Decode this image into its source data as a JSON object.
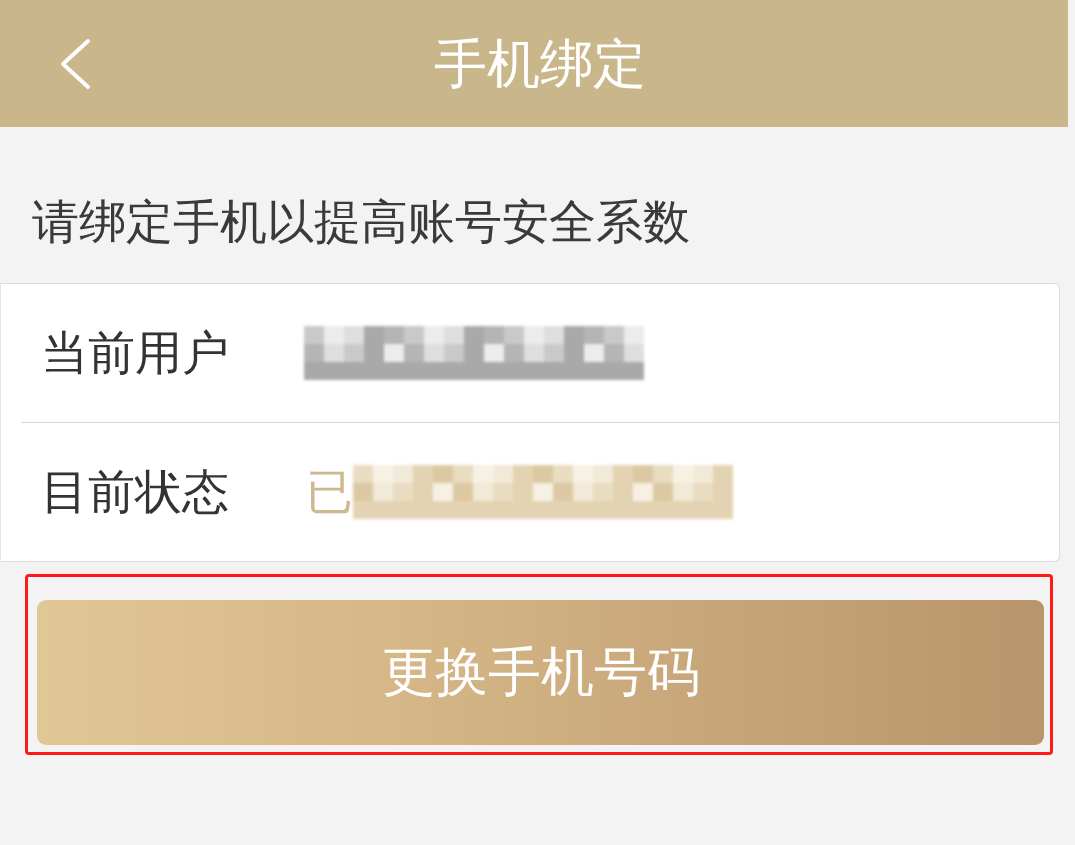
{
  "header": {
    "title": "手机绑定"
  },
  "notice": "请绑定手机以提高账号安全系数",
  "fields": [
    {
      "label": "当前用户",
      "kind": "account",
      "redacted": true
    },
    {
      "label": "目前状态",
      "kind": "status",
      "value": "已",
      "redacted": true
    }
  ],
  "action": {
    "label": "更换手机号码",
    "highlighted": true
  }
}
